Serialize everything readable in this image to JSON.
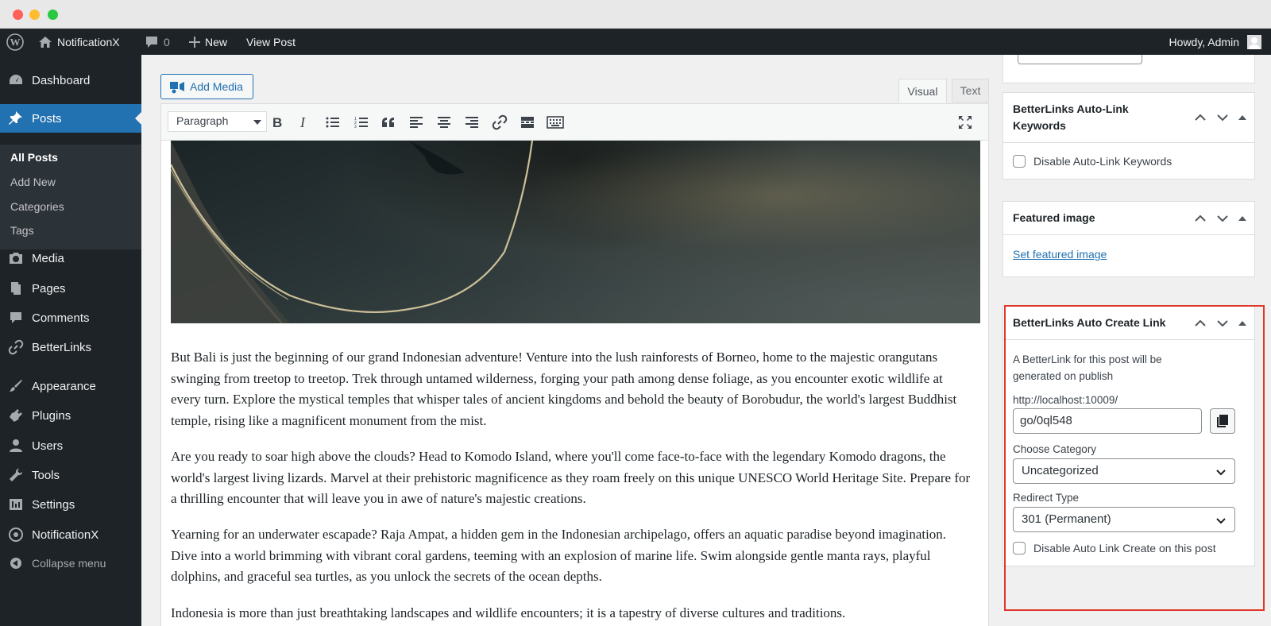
{
  "admin_bar": {
    "site_name": "NotificationX",
    "comments_count": "0",
    "new_label": "New",
    "view_post_label": "View Post",
    "howdy": "Howdy, Admin"
  },
  "sidebar": {
    "items": [
      {
        "label": "Dashboard",
        "icon": "dashboard-icon"
      },
      {
        "label": "Posts",
        "icon": "pin-icon",
        "active": true
      },
      {
        "label": "Media",
        "icon": "media-icon"
      },
      {
        "label": "Pages",
        "icon": "pages-icon"
      },
      {
        "label": "Comments",
        "icon": "comment-icon"
      },
      {
        "label": "BetterLinks",
        "icon": "link-icon"
      },
      {
        "label": "Appearance",
        "icon": "brush-icon"
      },
      {
        "label": "Plugins",
        "icon": "plugin-icon"
      },
      {
        "label": "Users",
        "icon": "user-icon"
      },
      {
        "label": "Tools",
        "icon": "wrench-icon"
      },
      {
        "label": "Settings",
        "icon": "settings-icon"
      },
      {
        "label": "NotificationX",
        "icon": "notificationx-icon"
      }
    ],
    "submenu": [
      "All Posts",
      "Add New",
      "Categories",
      "Tags"
    ],
    "collapse_label": "Collapse menu"
  },
  "editor": {
    "add_media_label": "Add Media",
    "tab_visual": "Visual",
    "tab_text": "Text",
    "format_value": "Paragraph",
    "paragraphs": [
      "But Bali is just the beginning of our grand Indonesian adventure! Venture into the lush rainforests of Borneo, home to the majestic orangutans swinging from treetop to treetop. Trek through untamed wilderness, forging your path among dense foliage, as you encounter exotic wildlife at every turn. Explore the mystical temples that whisper tales of ancient kingdoms and behold the beauty of Borobudur, the world's largest Buddhist temple, rising like a magnificent monument from the mist.",
      "Are you ready to soar high above the clouds? Head to Komodo Island, where you'll come face-to-face with the legendary Komodo dragons, the world's largest living lizards. Marvel at their prehistoric magnificence as they roam freely on this unique UNESCO World Heritage Site. Prepare for a thrilling encounter that will leave you in awe of nature's majestic creations.",
      "Yearning for an underwater escapade? Raja Ampat, a hidden gem in the Indonesian archipelago, offers an aquatic paradise beyond imagination. Dive into a world brimming with vibrant coral gardens, teeming with an explosion of marine life. Swim alongside gentle manta rays, playful dolphins, and graceful sea turtles, as you unlock the secrets of the ocean depths.",
      "Indonesia is more than just breathtaking landscapes and wildlife encounters; it is a tapestry of diverse cultures and traditions."
    ]
  },
  "boxes": {
    "autolink": {
      "title": "BetterLinks Auto-Link Keywords",
      "checkbox_label": "Disable Auto-Link Keywords"
    },
    "featured": {
      "title": "Featured image",
      "link_label": "Set featured image"
    },
    "autocreate": {
      "title": "BetterLinks Auto Create Link",
      "description": "A BetterLink for this post will be generated on publish",
      "base_url": "http://localhost:10009/",
      "slug_value": "go/0ql548",
      "category_label": "Choose Category",
      "category_value": "Uncategorized",
      "redirect_label": "Redirect Type",
      "redirect_value": "301 (Permanent)",
      "disable_label": "Disable Auto Link Create on this post"
    }
  }
}
